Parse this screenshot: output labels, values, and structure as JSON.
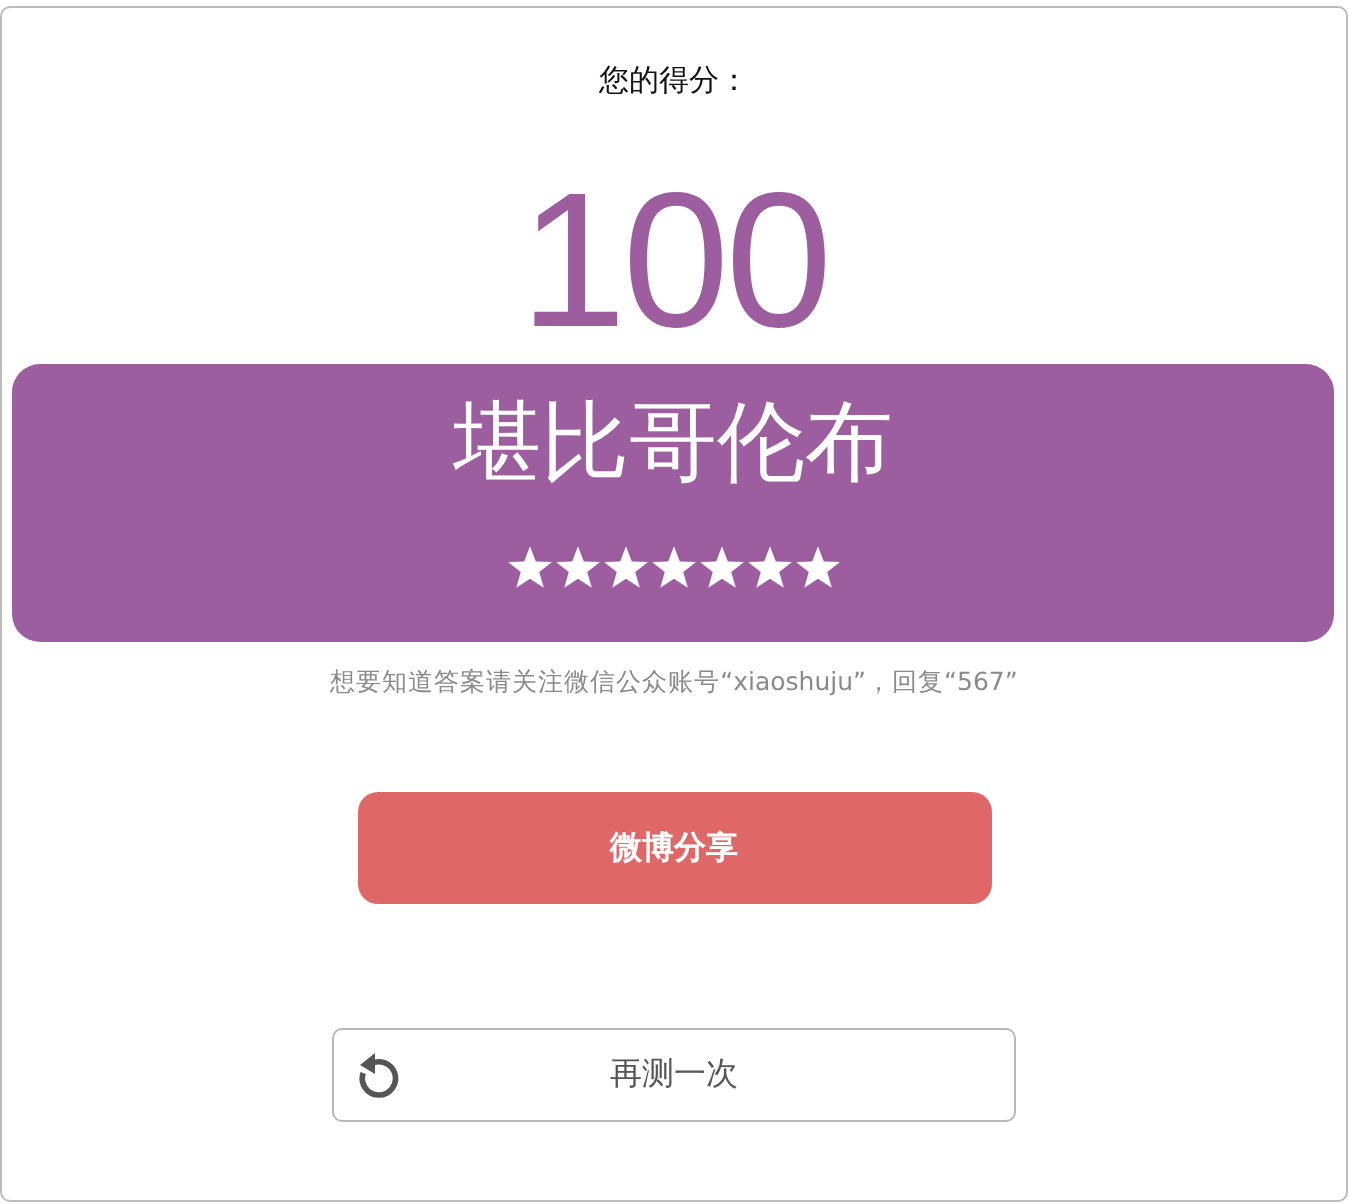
{
  "prompt": "您的得分：",
  "score": "100",
  "result": {
    "title": "堪比哥伦布",
    "stars": 7
  },
  "hint": "想要知道答案请关注微信公众账号“xiaoshuju”，回复“567”",
  "buttons": [
    {
      "kind": "share",
      "label": "微博分享"
    },
    {
      "kind": "retry",
      "label": "再测一次"
    }
  ]
}
